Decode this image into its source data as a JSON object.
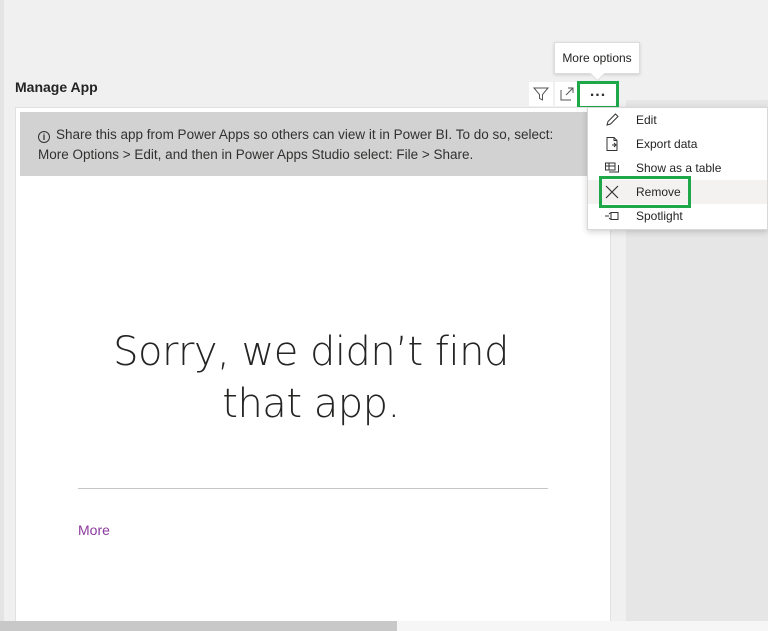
{
  "visual": {
    "title": "Manage App",
    "banner_text": "Share this app from Power Apps so others can view it in Power BI. To do so, select: More Options > Edit, and then in Power Apps Studio select: File > Share.",
    "message": "Sorry, we didn’t find that app.",
    "more_link": "More"
  },
  "header_icons": [
    {
      "name": "filter-icon"
    },
    {
      "name": "focus-mode-icon"
    },
    {
      "name": "more-options-icon",
      "label": "..."
    }
  ],
  "tooltip": {
    "text": "More options"
  },
  "menu": {
    "items": [
      {
        "icon": "pencil-icon",
        "label": "Edit"
      },
      {
        "icon": "export-data-icon",
        "label": "Export data"
      },
      {
        "icon": "table-icon",
        "label": "Show as a table"
      },
      {
        "icon": "close-icon",
        "label": "Remove"
      },
      {
        "icon": "spotlight-icon",
        "label": "Spotlight"
      }
    ]
  },
  "colors": {
    "highlight": "#1ea84a",
    "link": "#8b3a9e",
    "banner": "#d2d2d2"
  }
}
